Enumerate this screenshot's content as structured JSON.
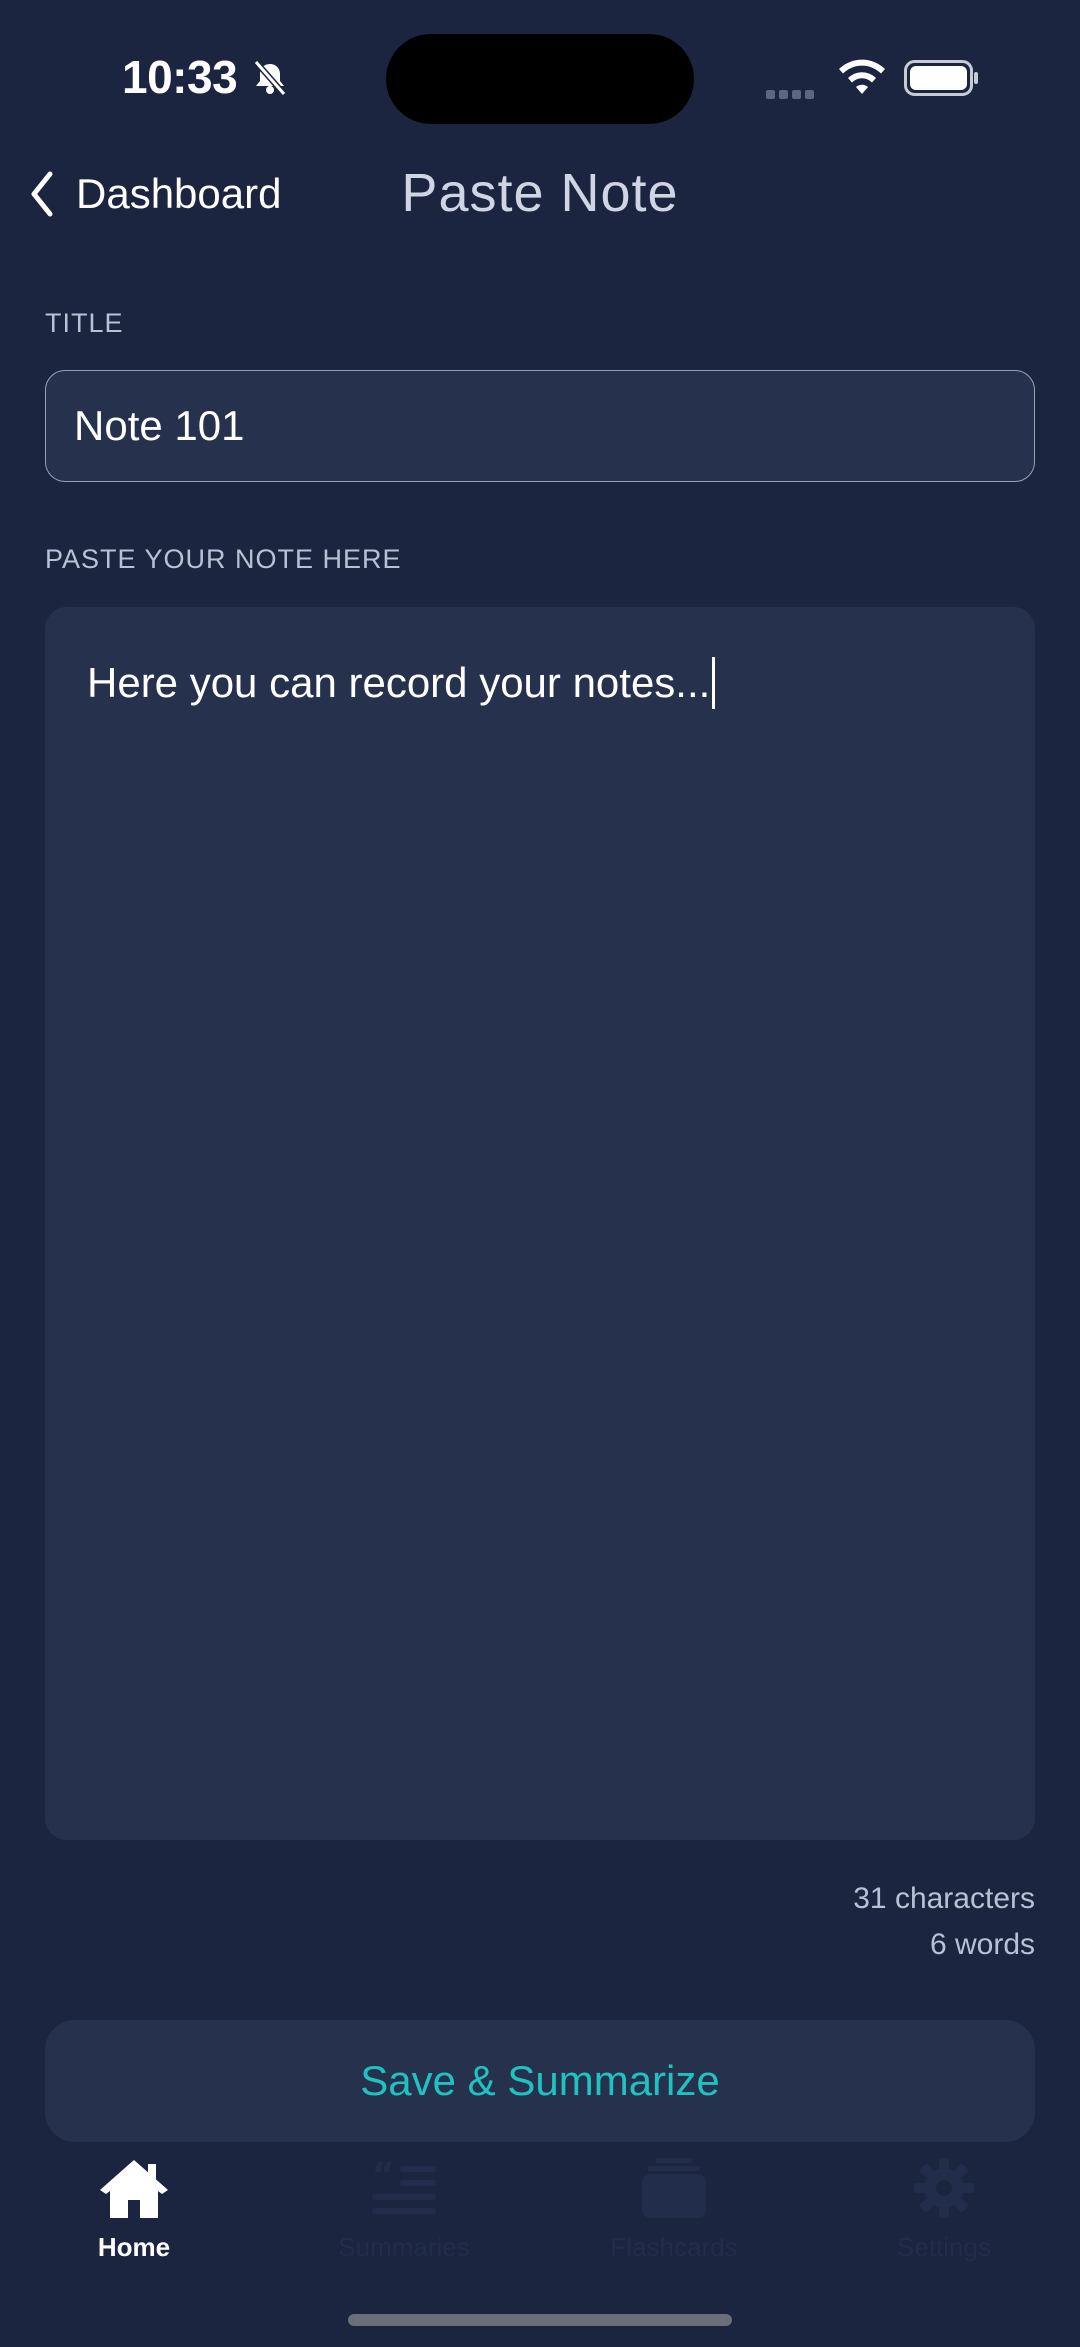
{
  "status_bar": {
    "time": "10:33"
  },
  "nav": {
    "back_label": "Dashboard",
    "title": "Paste Note"
  },
  "form": {
    "title_label": "TITLE",
    "title_value": "Note 101",
    "note_label": "PASTE YOUR NOTE HERE",
    "note_value": "Here you can record your notes..."
  },
  "counts": {
    "characters": "31 characters",
    "words": "6 words"
  },
  "actions": {
    "save_label": "Save & Summarize"
  },
  "tabs": [
    {
      "label": "Home",
      "icon": "home-icon",
      "active": true
    },
    {
      "label": "Summaries",
      "icon": "summaries-icon",
      "active": false
    },
    {
      "label": "Flashcards",
      "icon": "flashcards-icon",
      "active": false
    },
    {
      "label": "Settings",
      "icon": "gear-icon",
      "active": false
    }
  ],
  "colors": {
    "background": "#1b2540",
    "card": "#26324d",
    "accent": "#1fc2c0",
    "inactive_tab": "#222d4b"
  }
}
